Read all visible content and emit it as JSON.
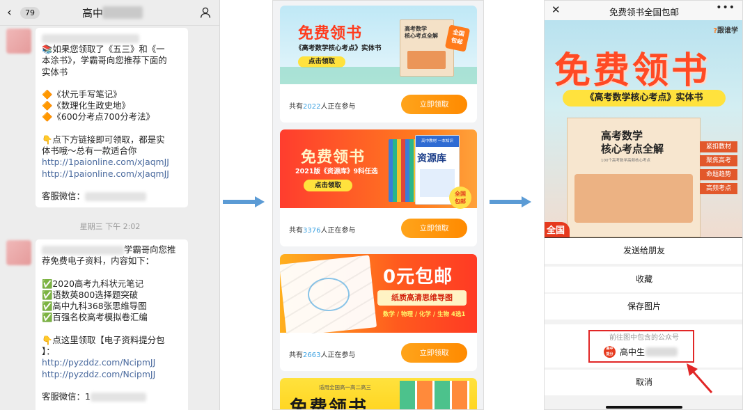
{
  "chat": {
    "back_icon": "chevron-left-icon",
    "unread_count": "79",
    "title": "高中",
    "person_icon": "person-icon",
    "message1": {
      "lines": [
        "📚如果您领取了《五三》和《一",
        "本涂书》，学霸哥向您推荐下面的",
        "实体书"
      ],
      "items": [
        "🔶《状元手写笔记》",
        "🔶《数理化生政史地》",
        "🔶《600分考点700分考法》"
      ],
      "cta_lines": [
        "👇点下方链接即可领取，都是实",
        "体书哦～总有一款适合你"
      ],
      "links": [
        "http://1paionline.com/xJaqmJJ",
        "http://1paionline.com/xJaqmJJ"
      ],
      "service_label": "客服微信："
    },
    "timestamp": "星期三 下午 2:02",
    "message2": {
      "intro_tail": "学霸哥向您推",
      "intro_line2": "荐免费电子资料，内容如下：",
      "items": [
        "✅2020高考九科状元笔记",
        "✅语数英800选择题突破",
        "✅高中九科368张思维导图",
        "✅百强名校高考模拟卷汇编"
      ],
      "cta_lines": [
        "👇点这里领取【电子资料提分包",
        "】："
      ],
      "links": [
        "http://pyzddz.com/NcipmJJ",
        "http://pyzddz.com/NcipmJJ"
      ],
      "service_label": "客服微信：1"
    }
  },
  "cards": [
    {
      "banner_title": "免费领书",
      "banner_sub": "《高考数学核心考点》实体书",
      "banner_button": "点击领取",
      "book_title": "高考数学\n核心考点全解",
      "badge": "全国\n包邮",
      "prefix": "共有",
      "count": "2022",
      "suffix": "人正在参与",
      "button": "立即领取"
    },
    {
      "banner_title": "免费领书",
      "banner_sub": "2021版《资源库》9科任选",
      "banner_button": "点击领取",
      "book_title": "资源库",
      "book_top": "高中教材  一本知识",
      "badge": "全国\n包邮",
      "prefix": "共有",
      "count": "3376",
      "suffix": "人正在参与",
      "button": "立即领取"
    },
    {
      "banner_title": "0元包邮",
      "banner_sub": "纸质高清思维导图",
      "banner_subjects": "数学 / 物理 / 化学 / 生物 4选1",
      "prefix": "共有",
      "count": "2663",
      "suffix": "人正在参与",
      "button": "立即领取"
    },
    {
      "banner_top": "适用全国高一高二高三",
      "banner_title": "免费领书"
    }
  ],
  "detail": {
    "title": "免费领书全国包邮",
    "close_icon": "close-icon",
    "more_icon": "more-icon",
    "brand": "跟谁学",
    "poster_title": "免费领书",
    "poster_sub": "《高考数学核心考点》实体书",
    "book_title": "高考数学\n核心考点全解",
    "book_small": "100个高考数学高频核心考点",
    "tags": [
      "紧扣教材",
      "聚焦高考",
      "命题趋势",
      "高频考点"
    ],
    "bottom_badge": "全国",
    "sheet": {
      "send": "发送给朋友",
      "favorite": "收藏",
      "save": "保存图片",
      "qr_label": "前往图中包含的公众号",
      "account_logo": "高中\n提分",
      "account_name": "高中生",
      "cancel": "取消"
    }
  },
  "colors": {
    "accent_orange": "#ff8a00",
    "link_blue": "#4a6a9e",
    "count_blue": "#3aa0e0",
    "highlight_red": "#e12626",
    "arrow_blue": "#5b9bd5"
  }
}
